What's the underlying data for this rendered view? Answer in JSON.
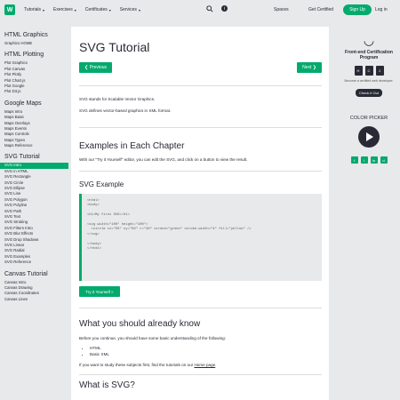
{
  "nav": {
    "logo": "W",
    "items": [
      {
        "label": "Tutorials",
        "chevron": "▾"
      },
      {
        "label": "Exercises",
        "chevron": "▾"
      },
      {
        "label": "Certificates",
        "chevron": "▾"
      },
      {
        "label": "Services",
        "chevron": "▾"
      }
    ],
    "spaces": "Spaces",
    "get_certified": "Get Certified",
    "sign_up": "Sign Up",
    "log_in": "Log in",
    "search_icon": "search-icon",
    "info_icon": "i"
  },
  "sidebar": {
    "sections": [
      {
        "heading": "HTML Graphics",
        "items": [
          "Graphics HOME"
        ]
      },
      {
        "heading": "HTML Plotting",
        "items": [
          "Plot Graphics",
          "Plot Canvas",
          "Plot Plotly",
          "Plot Chart.js",
          "Plot Google",
          "Plot D3.js"
        ]
      },
      {
        "heading": "Google Maps",
        "items": [
          "Maps Intro",
          "Maps Basic",
          "Maps Overlays",
          "Maps Events",
          "Maps Controls",
          "Maps Types",
          "Maps Reference"
        ]
      },
      {
        "heading": "SVG Tutorial",
        "items": [
          "SVG Intro",
          "SVG in HTML",
          "SVG Rectangle",
          "SVG Circle",
          "SVG Ellipse",
          "SVG Line",
          "SVG Polygon",
          "SVG Polyline",
          "SVG Path",
          "SVG Text",
          "SVG Stroking",
          "SVG Filters Intro",
          "SVG Blur Effects",
          "SVG Drop Shadows",
          "SVG Linear",
          "SVG Radial",
          "SVG Examples",
          "SVG Reference"
        ],
        "active_index": 0
      },
      {
        "heading": "Canvas Tutorial",
        "items": [
          "Canvas Intro",
          "Canvas Drawing",
          "Canvas Coordinates",
          "Canvas Lines"
        ]
      }
    ]
  },
  "main": {
    "title": "SVG Tutorial",
    "prev": "❮ Previous",
    "next": "Next ❯",
    "intro1": "SVG stands for Scalable Vector Graphics.",
    "intro2": "SVG defines vector-based graphics in XML format.",
    "examples_heading": "Examples in Each Chapter",
    "examples_text": "With our \"Try it Yourself\" editor, you can edit the SVG, and click on a button to view the result.",
    "svg_example_heading": "SVG Example",
    "code": [
      "<html>",
      "<body>",
      "",
      "<h1>My first SVG</h1>",
      "",
      "<svg width=\"100\" height=\"100\">",
      "  <circle cx=\"50\" cy=\"50\" r=\"40\" stroke=\"green\" stroke-width=\"4\" fill=\"yellow\" />",
      "</svg>",
      "",
      "</body>",
      "</html>"
    ],
    "try_it": "Try it Yourself »",
    "know_heading": "What you should already know",
    "know_text": "Before you continue, you should have some basic understanding of the following:",
    "know_list": [
      "HTML",
      "Basic XML"
    ],
    "study_text": "If you want to study these subjects first, find the tutorials on our",
    "study_link": "Home page",
    "study_end": ".",
    "next_heading": "What is SVG?"
  },
  "right": {
    "smile": "◡",
    "frontend_title": "Front-end Certification Program",
    "badges": [
      "H",
      "C",
      "J"
    ],
    "mini": "Become a certified web developer.",
    "checkout": "Check it Out",
    "color_picker": "COLOR PICKER",
    "socials": [
      "f",
      "i",
      "in",
      "d"
    ]
  },
  "colors": {
    "accent": "#04aa6d",
    "dark": "#282a35",
    "light_bg": "#e7e9eb"
  }
}
